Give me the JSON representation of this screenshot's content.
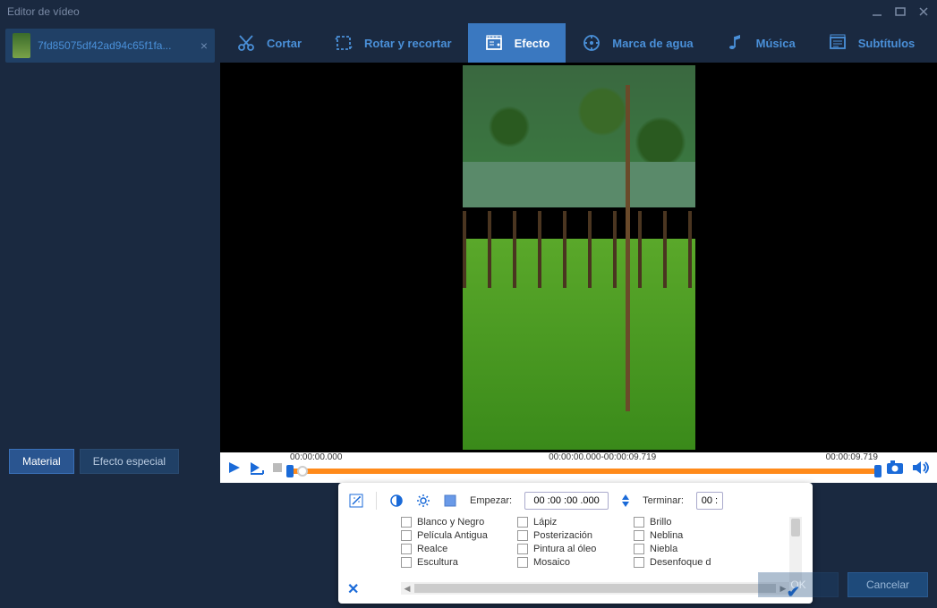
{
  "window": {
    "title": "Editor de vídeo"
  },
  "file_tab": {
    "filename": "7fd85075df42ad94c65f1fa..."
  },
  "toolbar": {
    "cortar": "Cortar",
    "rotar": "Rotar y recortar",
    "efecto": "Efecto",
    "marca": "Marca de agua",
    "musica": "Música",
    "subtitulos": "Subtítulos"
  },
  "sidebar": {
    "material": "Material",
    "efecto_especial": "Efecto especial"
  },
  "timeline": {
    "start": "00:00:00.000",
    "range": "00:00:00.000-00:00:09.719",
    "end": "00:00:09.719"
  },
  "effects": {
    "empezar_label": "Empezar:",
    "empezar_value": "00 :00 :00 .000",
    "terminar_label": "Terminar:",
    "terminar_value": "00 :",
    "col1": [
      "Blanco y Negro",
      "Película Antigua",
      "Realce",
      "Escultura"
    ],
    "col2": [
      "Lápiz",
      "Posterización",
      "Pintura al óleo",
      "Mosaico"
    ],
    "col3": [
      "Brillo",
      "Neblina",
      "Niebla",
      "Desenfoque d"
    ]
  },
  "actions": {
    "ok": "OK",
    "cancelar": "Cancelar"
  }
}
